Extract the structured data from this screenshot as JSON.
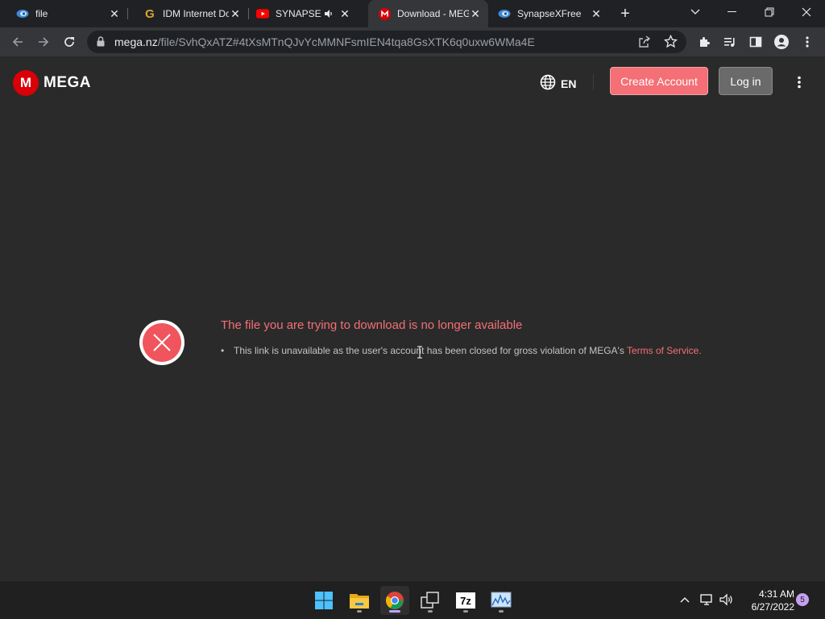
{
  "browser": {
    "tabs": [
      {
        "title": "file",
        "icon": "synapse-eye-icon",
        "active": false
      },
      {
        "title": "IDM Internet Dow",
        "icon": "idm-g-icon",
        "active": false
      },
      {
        "title": "SYNAPSE X",
        "icon": "youtube-icon",
        "active": false,
        "audio": true
      },
      {
        "title": "Download - MEGA",
        "icon": "mega-icon",
        "active": true
      },
      {
        "title": "SynapseXFree",
        "icon": "synapse-eye-icon",
        "active": false
      }
    ],
    "url_host": "mega.nz",
    "url_path": "/file/SvhQxATZ#4tXsMTnQJvYcMMNFsmIEN4tqa8GsXTK6q0uxw6WMa4E"
  },
  "mega": {
    "logo_text": "MEGA",
    "logo_letter": "M",
    "language": "EN",
    "create_account": "Create Account",
    "login": "Log in",
    "error_title": "The file you are trying to download is no longer available",
    "error_text": "This link is unavailable as the user's account has been closed for gross violation of MEGA's",
    "tos_link": "Terms of Service",
    "tos_suffix": "."
  },
  "taskbar": {
    "apps": [
      "windows-start-icon",
      "file-explorer-icon",
      "chrome-icon",
      "task-view-icon",
      "7zip-icon",
      "resource-monitor-icon"
    ],
    "app_7zip_label": "7z",
    "time": "4:31 AM",
    "date": "6/27/2022",
    "notification_count": "5"
  },
  "colors": {
    "mega_red": "#d90007",
    "accent_pink": "#f46f76",
    "page_bg": "#2a2a2a"
  }
}
